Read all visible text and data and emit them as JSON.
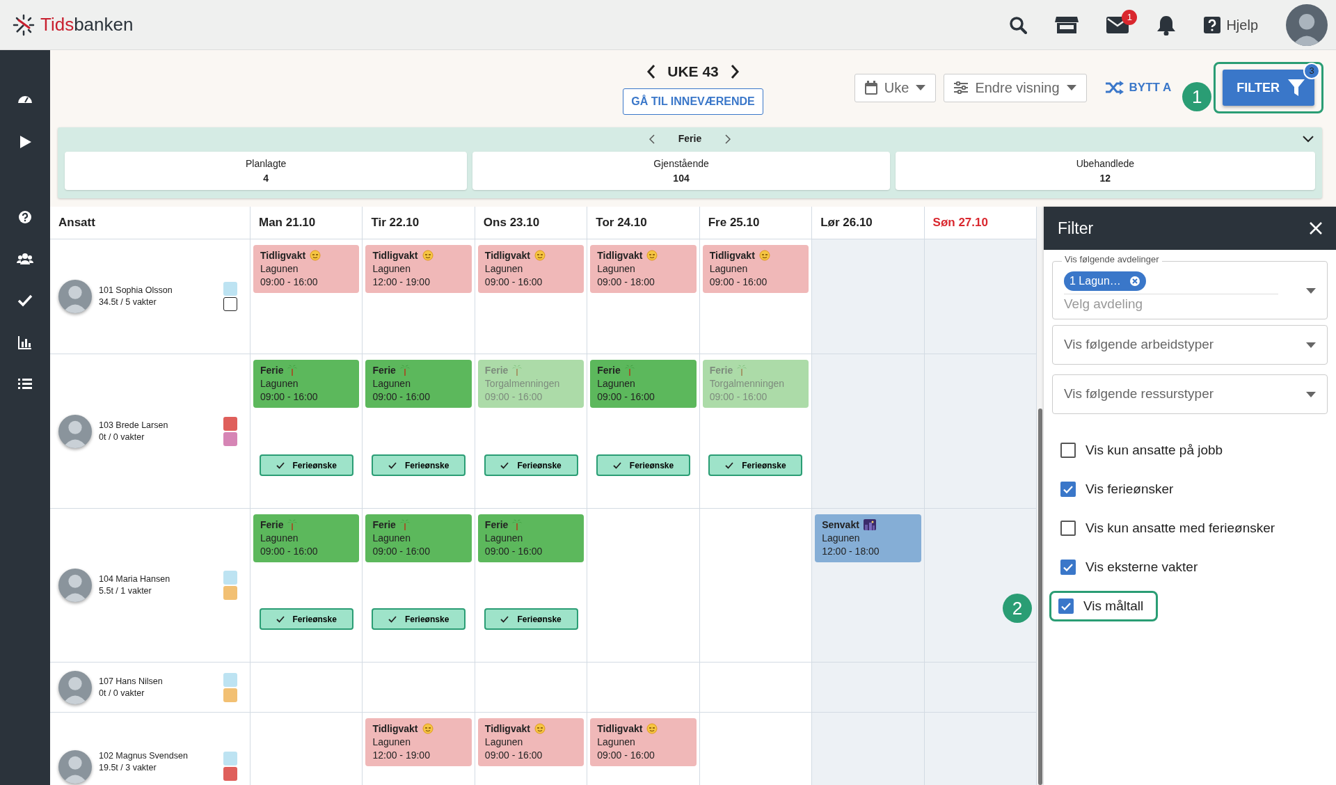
{
  "topbar": {
    "logo": {
      "accent": "Tids",
      "rest": "banken"
    },
    "mail_badge": "1",
    "help": "Hjelp"
  },
  "toolbar": {
    "week": "UKE 43",
    "today_button": "GÅ TIL INNEVÆRENDE",
    "period_dropdown": "Uke",
    "view_dropdown": "Endre visning",
    "swap_button": "BYTT A",
    "filter_button": {
      "label": "FILTER",
      "badge": "3",
      "callout": "1"
    }
  },
  "summary": {
    "title": "Ferie",
    "stats": [
      {
        "label": "Planlagte",
        "value": "4"
      },
      {
        "label": "Gjenstående",
        "value": "104"
      },
      {
        "label": "Ubehandlede",
        "value": "12"
      }
    ]
  },
  "schedule": {
    "employee_header": "Ansatt",
    "days": [
      {
        "label": "Man 21.10",
        "kind": "weekday"
      },
      {
        "label": "Tir 22.10",
        "kind": "weekday"
      },
      {
        "label": "Ons 23.10",
        "kind": "weekday"
      },
      {
        "label": "Tor 24.10",
        "kind": "weekday"
      },
      {
        "label": "Fre 25.10",
        "kind": "weekday"
      },
      {
        "label": "Lør 26.10",
        "kind": "saturday"
      },
      {
        "label": "Søn 27.10",
        "kind": "sunday"
      }
    ],
    "employees": [
      {
        "name": "101 Sophia Olsson",
        "hours": "34.5t / 5 vakter",
        "tags": [
          {
            "color": "#bde3f2"
          },
          {
            "color": "#ffffff"
          }
        ],
        "shifts": [
          {
            "kind": "early",
            "title": "Tidligvakt",
            "location": "Lagunen",
            "time": "09:00 - 16:00"
          },
          {
            "kind": "early",
            "title": "Tidligvakt",
            "location": "Lagunen",
            "time": "12:00 - 19:00"
          },
          {
            "kind": "early",
            "title": "Tidligvakt",
            "location": "Lagunen",
            "time": "09:00 - 16:00"
          },
          {
            "kind": "early",
            "title": "Tidligvakt",
            "location": "Lagunen",
            "time": "09:00 - 18:00"
          },
          {
            "kind": "early",
            "title": "Tidligvakt",
            "location": "Lagunen",
            "time": "09:00 - 16:00"
          },
          {
            "kind": "empty"
          },
          {
            "kind": "empty"
          }
        ]
      },
      {
        "name": "103 Brede Larsen",
        "hours": "0t / 0 vakter",
        "tags": [
          {
            "color": "#df5f5b"
          },
          {
            "color": "#d685b5"
          }
        ],
        "shifts": [
          {
            "kind": "vacation",
            "title": "Ferie",
            "location": "Lagunen",
            "time": "09:00 - 16:00",
            "faded": false,
            "wish": "Ferieønske"
          },
          {
            "kind": "vacation",
            "title": "Ferie",
            "location": "Lagunen",
            "time": "09:00 - 16:00",
            "faded": false,
            "wish": "Ferieønske"
          },
          {
            "kind": "vacation",
            "title": "Ferie",
            "location": "Torgalmenningen",
            "time": "09:00 - 16:00",
            "faded": true,
            "wish": "Ferieønske"
          },
          {
            "kind": "vacation",
            "title": "Ferie",
            "location": "Lagunen",
            "time": "09:00 - 16:00",
            "faded": false,
            "wish": "Ferieønske"
          },
          {
            "kind": "vacation",
            "title": "Ferie",
            "location": "Torgalmenningen",
            "time": "09:00 - 16:00",
            "faded": true,
            "wish": "Ferieønske"
          },
          {
            "kind": "empty"
          },
          {
            "kind": "empty"
          }
        ]
      },
      {
        "name": "104 Maria Hansen",
        "hours": "5.5t / 1 vakter",
        "tags": [
          {
            "color": "#bde3f2"
          },
          {
            "color": "#f2c073"
          }
        ],
        "shifts": [
          {
            "kind": "vacation",
            "title": "Ferie",
            "location": "Lagunen",
            "time": "09:00 - 16:00",
            "faded": false,
            "wish": "Ferieønske"
          },
          {
            "kind": "vacation",
            "title": "Ferie",
            "location": "Lagunen",
            "time": "09:00 - 16:00",
            "faded": false,
            "wish": "Ferieønske"
          },
          {
            "kind": "vacation",
            "title": "Ferie",
            "location": "Lagunen",
            "time": "09:00 - 16:00",
            "faded": false,
            "wish": "Ferieønske"
          },
          {
            "kind": "empty"
          },
          {
            "kind": "empty"
          },
          {
            "kind": "evening",
            "title": "Senvakt",
            "location": "Lagunen",
            "time": "12:00 - 18:00"
          },
          {
            "kind": "empty"
          }
        ]
      },
      {
        "name": "107 Hans Nilsen",
        "hours": "0t / 0 vakter",
        "tags": [
          {
            "color": "#bde3f2"
          },
          {
            "color": "#f2c073"
          }
        ],
        "shifts": [
          {
            "kind": "empty"
          },
          {
            "kind": "empty"
          },
          {
            "kind": "empty"
          },
          {
            "kind": "empty"
          },
          {
            "kind": "empty"
          },
          {
            "kind": "empty"
          },
          {
            "kind": "empty"
          }
        ]
      },
      {
        "name": "102 Magnus Svendsen",
        "hours": "19.5t / 3 vakter",
        "tags": [
          {
            "color": "#bde3f2"
          },
          {
            "color": "#df5f5b"
          }
        ],
        "shifts": [
          {
            "kind": "empty"
          },
          {
            "kind": "early",
            "title": "Tidligvakt",
            "location": "Lagunen",
            "time": "12:00 - 19:00"
          },
          {
            "kind": "early",
            "title": "Tidligvakt",
            "location": "Lagunen",
            "time": "09:00 - 16:00"
          },
          {
            "kind": "early",
            "title": "Tidligvakt",
            "location": "Lagunen",
            "time": "09:00 - 16:00"
          },
          {
            "kind": "empty"
          },
          {
            "kind": "empty"
          },
          {
            "kind": "empty"
          }
        ]
      }
    ]
  },
  "filter": {
    "title": "Filter",
    "department_select": {
      "label": "Vis følgende avdelinger",
      "chip": "1 Lagun…",
      "placeholder": "Velg avdeling"
    },
    "selects": [
      {
        "placeholder": "Vis følgende arbeidstyper"
      },
      {
        "placeholder": "Vis følgende ressurstyper"
      }
    ],
    "options": [
      {
        "label": "Vis kun ansatte på jobb",
        "checked": false
      },
      {
        "label": "Vis ferieønsker",
        "checked": true
      },
      {
        "label": "Vis kun ansatte med ferieønsker",
        "checked": false
      },
      {
        "label": "Vis eksterne vakter",
        "checked": true
      },
      {
        "label": "Vis måltall",
        "checked": true,
        "callout": "2"
      }
    ]
  }
}
